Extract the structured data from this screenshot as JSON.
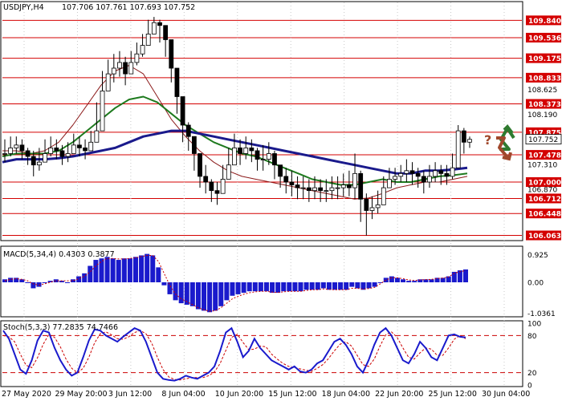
{
  "chart_data": {
    "type": "candlestick",
    "symbol": "USDJPY,H4",
    "ohlc_header": "107.706 107.761 107.693 107.752",
    "x_labels": [
      "27 May 2020",
      "29 May 20:00",
      "3 Jun 12:00",
      "8 Jun 04:00",
      "10 Jun 20:00",
      "15 Jun 12:00",
      "18 Jun 04:00",
      "22 Jun 20:00",
      "25 Jun 12:00",
      "30 Jun 04:00"
    ],
    "price_axis": {
      "ylim": [
        106.0,
        110.0
      ],
      "ticks": [
        109.84,
        109.536,
        109.175,
        108.833,
        108.625,
        108.373,
        108.19,
        107.875,
        107.752,
        107.478,
        107.31,
        107.0,
        106.87,
        106.712,
        106.448,
        106.063
      ]
    },
    "levels": [
      109.84,
      109.536,
      109.175,
      108.833,
      108.373,
      107.875,
      107.478,
      107.0,
      106.712,
      106.448,
      106.063
    ],
    "last_price": 107.752,
    "close": [
      107.5,
      107.6,
      107.65,
      107.55,
      107.45,
      107.3,
      107.35,
      107.5,
      107.6,
      107.55,
      107.45,
      107.5,
      107.65,
      107.6,
      107.55,
      107.7,
      107.9,
      108.6,
      108.9,
      109.0,
      109.1,
      108.9,
      109.1,
      109.25,
      109.4,
      109.6,
      109.8,
      109.75,
      109.5,
      109.0,
      108.5,
      108.0,
      107.8,
      107.5,
      107.1,
      107.0,
      106.85,
      106.8,
      107.05,
      107.3,
      107.6,
      107.5,
      107.6,
      107.55,
      107.4,
      107.4,
      107.5,
      107.3,
      107.1,
      107.0,
      106.95,
      106.9,
      106.9,
      106.85,
      106.9,
      106.85,
      106.85,
      106.9,
      106.9,
      106.95,
      106.9,
      107.15,
      106.7,
      106.5,
      106.55,
      106.6,
      106.9,
      107.05,
      107.1,
      107.15,
      107.2,
      107.15,
      107.1,
      107.0,
      107.1,
      107.2,
      107.15,
      107.1,
      107.25,
      107.9,
      107.7,
      107.75
    ],
    "high": [
      107.75,
      107.8,
      107.8,
      107.75,
      107.6,
      107.55,
      107.6,
      107.75,
      107.8,
      107.75,
      107.65,
      107.7,
      107.85,
      107.8,
      107.75,
      107.9,
      108.4,
      108.95,
      109.15,
      109.25,
      109.3,
      109.2,
      109.3,
      109.45,
      109.6,
      109.85,
      109.9,
      109.85,
      109.7,
      109.4,
      109.0,
      108.3,
      108.05,
      107.8,
      107.45,
      107.3,
      107.05,
      107.0,
      107.3,
      107.6,
      107.85,
      107.75,
      107.8,
      107.75,
      107.6,
      107.65,
      107.7,
      107.55,
      107.3,
      107.25,
      107.2,
      107.1,
      107.1,
      107.05,
      107.1,
      107.05,
      107.05,
      107.1,
      107.1,
      107.15,
      107.2,
      107.5,
      107.2,
      106.8,
      106.75,
      106.85,
      107.1,
      107.25,
      107.25,
      107.3,
      107.4,
      107.35,
      107.25,
      107.2,
      107.3,
      107.35,
      107.3,
      107.3,
      107.5,
      108.0,
      107.95,
      107.8
    ],
    "low": [
      107.35,
      107.45,
      107.5,
      107.4,
      107.3,
      107.1,
      107.2,
      107.35,
      107.45,
      107.4,
      107.3,
      107.35,
      107.5,
      107.45,
      107.4,
      107.55,
      107.75,
      108.2,
      108.6,
      108.75,
      108.85,
      108.7,
      108.9,
      109.05,
      109.2,
      109.4,
      109.6,
      109.45,
      109.2,
      108.75,
      108.2,
      107.7,
      107.55,
      107.2,
      106.9,
      106.8,
      106.65,
      106.6,
      106.8,
      107.1,
      107.4,
      107.3,
      107.4,
      107.35,
      107.2,
      107.2,
      107.3,
      107.05,
      106.9,
      106.8,
      106.75,
      106.7,
      106.7,
      106.65,
      106.7,
      106.65,
      106.65,
      106.7,
      106.7,
      106.75,
      106.75,
      106.7,
      106.3,
      106.06,
      106.35,
      106.45,
      106.6,
      106.9,
      106.95,
      107.0,
      107.0,
      106.95,
      106.9,
      106.8,
      106.9,
      107.0,
      106.95,
      106.95,
      107.05,
      107.3,
      107.5,
      107.6
    ],
    "ma_blue_series": [
      107.35,
      107.4,
      107.4,
      107.4,
      107.42,
      107.45,
      107.5,
      107.55,
      107.6,
      107.7,
      107.8,
      107.85,
      107.9,
      107.9,
      107.85,
      107.8,
      107.75,
      107.7,
      107.65,
      107.6,
      107.55,
      107.5,
      107.45,
      107.4,
      107.35,
      107.3,
      107.25,
      107.2,
      107.15,
      107.15,
      107.2,
      107.2,
      107.22,
      107.25
    ],
    "ma_green_series": [
      107.45,
      107.5,
      107.5,
      107.5,
      107.55,
      107.7,
      107.9,
      108.1,
      108.3,
      108.45,
      108.5,
      108.4,
      108.2,
      108.0,
      107.85,
      107.7,
      107.6,
      107.5,
      107.45,
      107.35,
      107.25,
      107.15,
      107.05,
      107.0,
      106.95,
      106.95,
      107.0,
      107.05,
      107.0,
      107.0,
      107.05,
      107.1,
      107.12,
      107.15
    ],
    "ma_red_series": [
      107.55,
      107.55,
      107.5,
      107.55,
      107.7,
      108.0,
      108.35,
      108.7,
      108.95,
      109.05,
      108.9,
      108.5,
      108.1,
      107.8,
      107.55,
      107.35,
      107.2,
      107.1,
      107.05,
      107.0,
      106.95,
      106.9,
      106.85,
      106.8,
      106.75,
      106.7,
      106.72,
      106.8,
      106.9,
      106.95,
      107.0,
      107.0,
      107.05,
      107.1
    ],
    "macd": {
      "label": "MACD(5,34,4) 0.4303 0.3877",
      "ylim": [
        -1.1,
        1.1
      ],
      "ticks": [
        0.925,
        0.0,
        -1.0361
      ],
      "hist": [
        0.1,
        0.15,
        0.15,
        0.1,
        0.0,
        -0.2,
        -0.15,
        0.0,
        0.05,
        0.1,
        0.05,
        0.0,
        0.1,
        0.2,
        0.3,
        0.55,
        0.75,
        0.8,
        0.85,
        0.8,
        0.75,
        0.8,
        0.8,
        0.85,
        0.9,
        0.95,
        0.9,
        0.5,
        -0.1,
        -0.4,
        -0.6,
        -0.7,
        -0.75,
        -0.8,
        -0.9,
        -0.95,
        -1.0,
        -0.95,
        -0.8,
        -0.6,
        -0.45,
        -0.4,
        -0.35,
        -0.3,
        -0.3,
        -0.3,
        -0.3,
        -0.35,
        -0.35,
        -0.3,
        -0.3,
        -0.3,
        -0.3,
        -0.25,
        -0.25,
        -0.25,
        -0.2,
        -0.25,
        -0.25,
        -0.25,
        -0.25,
        -0.15,
        -0.2,
        -0.25,
        -0.2,
        -0.15,
        0.0,
        0.15,
        0.2,
        0.15,
        0.1,
        0.05,
        0.05,
        0.1,
        0.1,
        0.1,
        0.15,
        0.15,
        0.2,
        0.35,
        0.4,
        0.43
      ],
      "signal": [
        0.05,
        0.1,
        0.12,
        0.1,
        0.05,
        -0.05,
        -0.1,
        -0.05,
        0.0,
        0.05,
        0.05,
        0.05,
        0.05,
        0.12,
        0.2,
        0.35,
        0.55,
        0.7,
        0.8,
        0.8,
        0.78,
        0.78,
        0.8,
        0.82,
        0.86,
        0.9,
        0.9,
        0.7,
        0.3,
        -0.1,
        -0.4,
        -0.55,
        -0.65,
        -0.75,
        -0.85,
        -0.92,
        -0.97,
        -0.95,
        -0.85,
        -0.7,
        -0.55,
        -0.47,
        -0.4,
        -0.35,
        -0.32,
        -0.3,
        -0.3,
        -0.33,
        -0.34,
        -0.32,
        -0.3,
        -0.3,
        -0.3,
        -0.27,
        -0.25,
        -0.25,
        -0.22,
        -0.24,
        -0.25,
        -0.25,
        -0.25,
        -0.2,
        -0.2,
        -0.23,
        -0.21,
        -0.17,
        -0.05,
        0.08,
        0.15,
        0.15,
        0.12,
        0.08,
        0.06,
        0.08,
        0.09,
        0.1,
        0.13,
        0.14,
        0.18,
        0.3,
        0.36,
        0.39
      ]
    },
    "stoch": {
      "label": "Stoch(5,3,3) 77.2835 74.7466",
      "ylim": [
        0,
        100
      ],
      "ticks": [
        100,
        80,
        20,
        0
      ],
      "levels": [
        80,
        20
      ],
      "k": [
        88,
        75,
        50,
        25,
        18,
        40,
        72,
        88,
        85,
        60,
        40,
        25,
        15,
        20,
        45,
        72,
        90,
        88,
        80,
        75,
        70,
        78,
        85,
        92,
        88,
        70,
        45,
        20,
        10,
        8,
        7,
        10,
        15,
        12,
        10,
        15,
        20,
        30,
        55,
        85,
        92,
        70,
        45,
        55,
        75,
        60,
        50,
        40,
        35,
        30,
        25,
        30,
        22,
        20,
        25,
        35,
        40,
        55,
        70,
        75,
        65,
        50,
        30,
        20,
        40,
        65,
        85,
        92,
        80,
        60,
        40,
        35,
        50,
        70,
        60,
        45,
        40,
        60,
        80,
        82,
        78,
        77
      ],
      "d": [
        80,
        78,
        70,
        50,
        32,
        28,
        44,
        66,
        82,
        77,
        62,
        42,
        27,
        20,
        27,
        45,
        68,
        83,
        86,
        81,
        75,
        74,
        78,
        85,
        88,
        83,
        68,
        45,
        25,
        13,
        9,
        8,
        10,
        12,
        12,
        12,
        15,
        21,
        35,
        56,
        77,
        82,
        69,
        57,
        58,
        63,
        62,
        50,
        42,
        35,
        30,
        28,
        26,
        24,
        22,
        27,
        33,
        43,
        55,
        66,
        70,
        63,
        48,
        33,
        30,
        42,
        63,
        81,
        86,
        77,
        60,
        45,
        42,
        52,
        60,
        58,
        48,
        48,
        60,
        74,
        80,
        75
      ]
    },
    "signals": {
      "question_mark": "?"
    }
  }
}
